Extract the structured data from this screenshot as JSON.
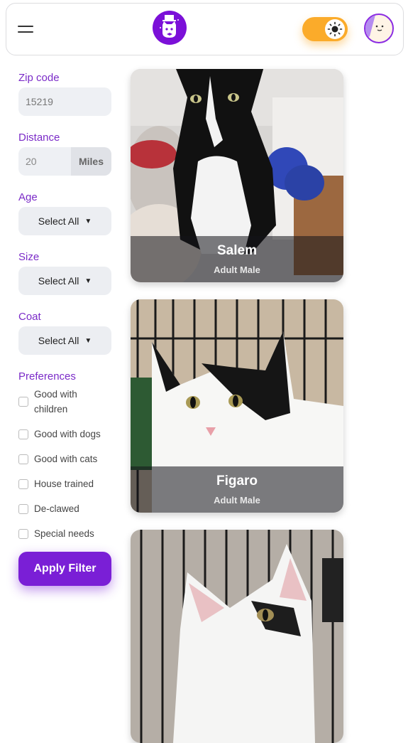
{
  "header": {
    "menu_icon": "hamburger-menu-icon",
    "logo_icon": "cat-wizard-logo-icon",
    "theme_toggle_icon": "sun-icon",
    "avatar_icon": "user-avatar-icon"
  },
  "filters": {
    "zip": {
      "label": "Zip code",
      "value": "15219"
    },
    "distance": {
      "label": "Distance",
      "value": "20",
      "unit": "Miles"
    },
    "age": {
      "label": "Age",
      "value": "Select All"
    },
    "size": {
      "label": "Size",
      "value": "Select All"
    },
    "coat": {
      "label": "Coat",
      "value": "Select All"
    },
    "preferences": {
      "label": "Preferences",
      "items": [
        "Good with children",
        "Good with dogs",
        "Good with cats",
        "House trained",
        "De-clawed",
        "Special needs"
      ]
    },
    "apply_label": "Apply Filter"
  },
  "pets": [
    {
      "name": "Salem",
      "description": "Adult Male"
    },
    {
      "name": "Figaro",
      "description": "Adult Male"
    },
    {
      "name": "",
      "description": ""
    }
  ],
  "colors": {
    "accent": "#7b10d8",
    "toggle": "#fbab2a",
    "label": "#7b2bc8"
  }
}
